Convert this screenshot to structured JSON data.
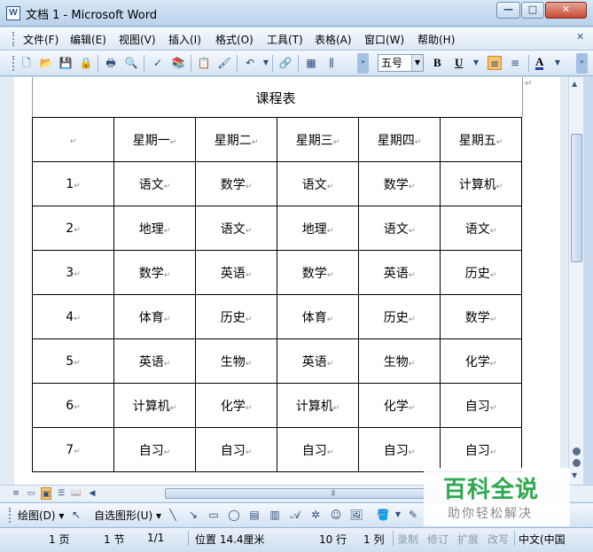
{
  "window": {
    "title": "文档 1 - Microsoft Word",
    "icon_label": "W",
    "min_glyph": "—",
    "max_glyph": "□",
    "close_glyph": "✕"
  },
  "menu": {
    "items": [
      "文件(F)",
      "编辑(E)",
      "视图(V)",
      "插入(I)",
      "格式(O)",
      "工具(T)",
      "表格(A)",
      "窗口(W)",
      "帮助(H)"
    ],
    "overflow_glyph": "✕"
  },
  "toolbar": {
    "font_size": "五号",
    "bold": "B",
    "underline": "U",
    "font_color_glyph": "A"
  },
  "document": {
    "title": "课程表",
    "header_row": [
      "",
      "星期一",
      "星期二",
      "星期三",
      "星期四",
      "星期五"
    ],
    "rows": [
      [
        "1",
        "语文",
        "数学",
        "语文",
        "数学",
        "计算机"
      ],
      [
        "2",
        "地理",
        "语文",
        "地理",
        "语文",
        "语文"
      ],
      [
        "3",
        "数学",
        "英语",
        "数学",
        "英语",
        "历史"
      ],
      [
        "4",
        "体育",
        "历史",
        "体育",
        "历史",
        "数学"
      ],
      [
        "5",
        "英语",
        "生物",
        "英语",
        "生物",
        "化学"
      ],
      [
        "6",
        "计算机",
        "化学",
        "计算机",
        "化学",
        "自习"
      ],
      [
        "7",
        "自习",
        "自习",
        "自习",
        "自习",
        "自习"
      ]
    ]
  },
  "drawing": {
    "draw_label": "绘图(D)",
    "autoshapes_label": "自选图形(U)"
  },
  "status": {
    "page": "1 页",
    "section": "1 节",
    "page_of": "1/1",
    "position": "位置 14.4厘米",
    "line": "10 行",
    "column": "1 列",
    "rec": "录制",
    "trk": "修订",
    "ext": "扩展",
    "ovr": "改写",
    "language": "中文(中国"
  },
  "watermark": {
    "title": "百科全说",
    "subtitle": "助你轻松解决"
  }
}
